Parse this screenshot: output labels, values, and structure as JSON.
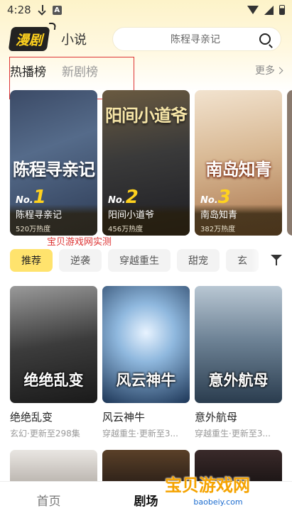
{
  "status_bar": {
    "time": "4:28"
  },
  "header": {
    "logo_text": "漫剧",
    "novel_tab": "小说",
    "search_placeholder": "陈程寻亲记"
  },
  "rank_tabs": {
    "tabs": [
      "热播榜",
      "新剧榜"
    ],
    "more": "更多"
  },
  "rank_cards": [
    {
      "prefix": "No.",
      "rank": "1",
      "name": "陈程寻亲记",
      "heat": "520万热度",
      "cover_title": "陈程寻亲记"
    },
    {
      "prefix": "No.",
      "rank": "2",
      "name": "阳间小道爷",
      "heat": "456万热度",
      "cover_title": "阳间小道爷"
    },
    {
      "prefix": "No.",
      "rank": "3",
      "name": "南岛知青",
      "heat": "382万热度",
      "cover_title": "南岛知青"
    }
  ],
  "watermark_top": "宝贝游戏网实测",
  "genres": [
    "推荐",
    "逆袭",
    "穿越重生",
    "甜宠",
    "玄"
  ],
  "dramas": [
    {
      "name": "绝绝乱变",
      "meta": "玄幻·更新至298集",
      "cover_title": "绝绝乱变"
    },
    {
      "name": "风云神牛",
      "meta": "穿越重生·更新至3...",
      "cover_title": "风云神牛"
    },
    {
      "name": "意外航母",
      "meta": "穿越重生·更新至3...",
      "cover_title": "意外航母"
    }
  ],
  "bottom_nav": {
    "home": "首页",
    "theater": "剧场"
  },
  "watermark_logo": {
    "title": "宝贝游戏网",
    "url": "baobeiy.com"
  }
}
